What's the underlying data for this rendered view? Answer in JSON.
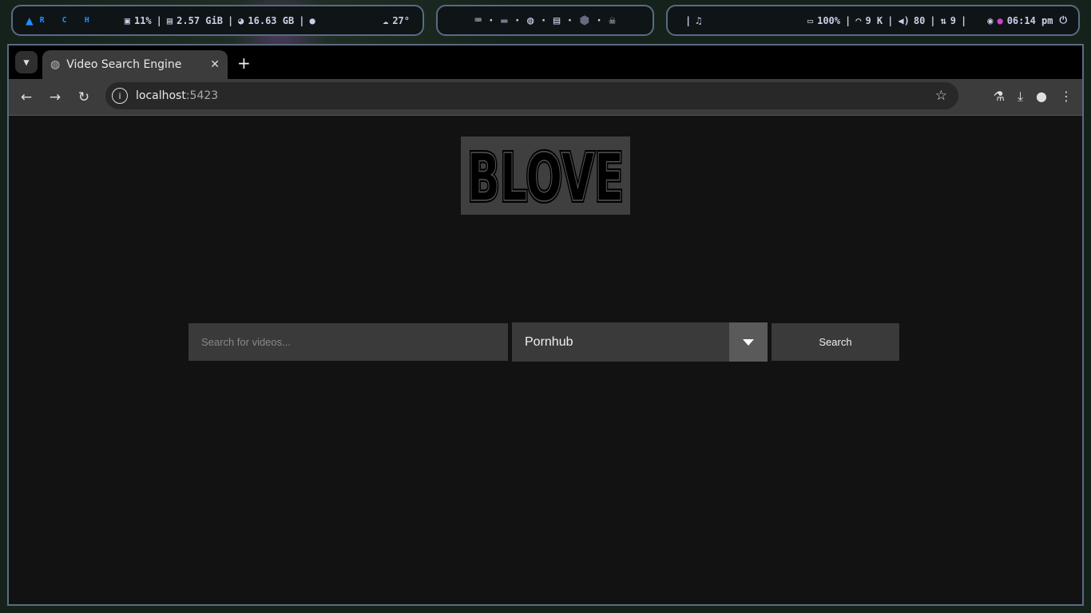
{
  "topbar": {
    "left": {
      "arch": "R C H",
      "cpu": "11%",
      "ram": "2.57 GiB",
      "disk": "16.63 GB",
      "weather": "27°"
    },
    "center": {
      "icons": [
        "terminal-icon",
        "folder-icon",
        "globe-icon",
        "chat-icon",
        "cube-icon",
        "skull-icon"
      ]
    },
    "right": {
      "battery": "100%",
      "wifi": "9 K",
      "volume": "80",
      "updates": "9",
      "clock": "06:14 pm"
    }
  },
  "browser": {
    "tab_title": "Video Search Engine",
    "url_host": "localhost",
    "url_port": ":5423"
  },
  "page": {
    "logo_text": "BLOVE",
    "search_placeholder": "Search for videos...",
    "source_selected": "Pornhub",
    "search_button": "Search"
  },
  "colors": {
    "accent": "#1e90ff",
    "bar_border": "#5a6b82",
    "page_bg": "#121212"
  }
}
